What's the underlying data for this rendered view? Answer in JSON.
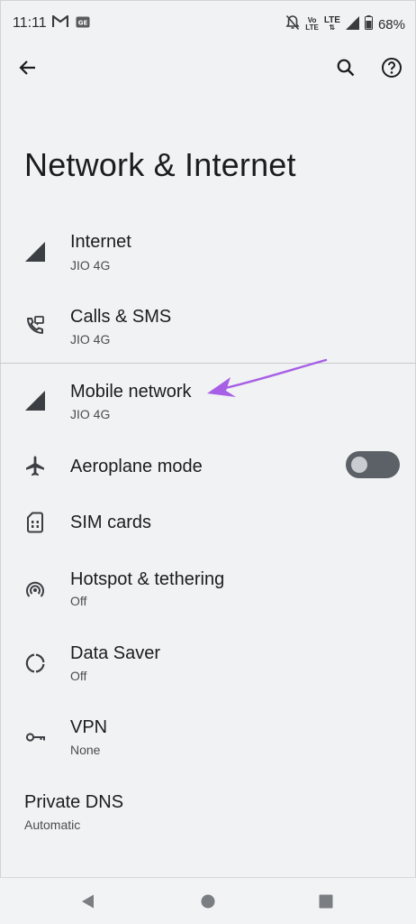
{
  "status_bar": {
    "time": "11:11",
    "volte_top": "Vo",
    "volte_bottom": "LTE",
    "lte": "LTE",
    "battery": "68%"
  },
  "header": {
    "title": "Network & Internet",
    "back_icon": "arrow-back-icon",
    "search_icon": "search-icon",
    "help_icon": "help-icon"
  },
  "items": [
    {
      "title": "Internet",
      "subtitle": "JIO 4G",
      "icon": "signal-icon"
    },
    {
      "title": "Calls & SMS",
      "subtitle": "JIO 4G",
      "icon": "phone-message-icon"
    },
    {
      "title": "Mobile network",
      "subtitle": "JIO 4G",
      "icon": "signal-icon"
    },
    {
      "title": "Aeroplane mode",
      "subtitle": "",
      "icon": "airplane-icon",
      "toggle_on": false
    },
    {
      "title": "SIM cards",
      "subtitle": "",
      "icon": "sim-card-icon"
    },
    {
      "title": "Hotspot & tethering",
      "subtitle": "Off",
      "icon": "hotspot-icon"
    },
    {
      "title": "Data Saver",
      "subtitle": "Off",
      "icon": "data-saver-icon"
    },
    {
      "title": "VPN",
      "subtitle": "None",
      "icon": "vpn-key-icon"
    },
    {
      "title": "Private DNS",
      "subtitle": "Automatic",
      "icon": ""
    }
  ],
  "annotation": {
    "color": "#a75fe6",
    "icon": "arrow-annotation"
  },
  "nav": {
    "back": "nav-back-icon",
    "home": "nav-home-icon",
    "recents": "nav-recents-icon"
  }
}
